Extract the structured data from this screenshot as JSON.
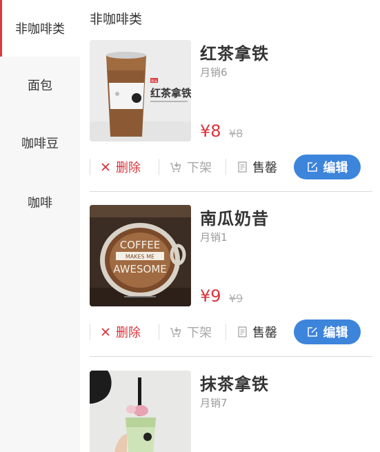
{
  "sidebar": {
    "items": [
      {
        "label": "非咖啡类"
      },
      {
        "label": "面包"
      },
      {
        "label": "咖啡豆"
      },
      {
        "label": "咖啡"
      }
    ]
  },
  "main": {
    "section_title": "非咖啡类",
    "products": [
      {
        "name": "红茶拿铁",
        "sales": "月销6",
        "price": "¥8",
        "original_price": "¥8",
        "cup_label": "红茶拿铁",
        "cup_tag": "新品"
      },
      {
        "name": "南瓜奶昔",
        "sales": "月销1",
        "price": "¥9",
        "original_price": "¥9",
        "latte_art": "COFFEE MAKES ME AWESOME"
      },
      {
        "name": "抹茶拿铁",
        "sales": "月销7",
        "price": "",
        "original_price": ""
      }
    ],
    "actions": {
      "delete": "删除",
      "take_down": "下架",
      "sold_out": "售罄",
      "edit": "编辑"
    }
  },
  "colors": {
    "accent_red": "#d9343b",
    "edit_blue": "#3d84db",
    "sidebar_bg": "#f7f7f7"
  },
  "icons": [
    "close-icon",
    "cart-down-icon",
    "document-icon",
    "edit-icon"
  ]
}
